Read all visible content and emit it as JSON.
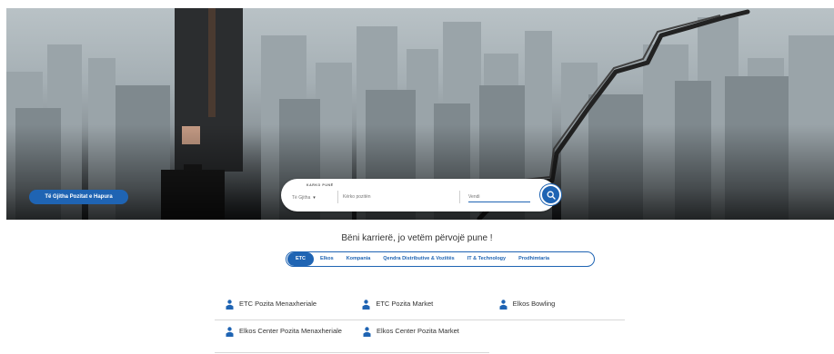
{
  "hero": {
    "all_jobs_button": "Të Gjitha Pozitat e Hapura",
    "search": {
      "caption": "KARKO PUNË",
      "category_value": "Të Gjitha",
      "job_placeholder": "Kërko pozitën",
      "location_placeholder": "Vendi"
    }
  },
  "tagline": "Bëni karrierë, jo vetëm përvojë pune !",
  "tabs": [
    {
      "label": "ETC",
      "active": true
    },
    {
      "label": "Elkos"
    },
    {
      "label": "Kompania"
    },
    {
      "label": "Qendra Distributive & Voziitës"
    },
    {
      "label": "IT & Technology"
    },
    {
      "label": "Prodhimtaria"
    }
  ],
  "positions": [
    {
      "label": "ETC Pozita Menaxheriale"
    },
    {
      "label": "ETC Pozita Market"
    },
    {
      "label": "Elkos Bowling"
    },
    {
      "label": "Elkos Center Pozita Menaxheriale"
    },
    {
      "label": "Elkos Center Pozita Market"
    }
  ],
  "colors": {
    "accent": "#1f64b3"
  }
}
